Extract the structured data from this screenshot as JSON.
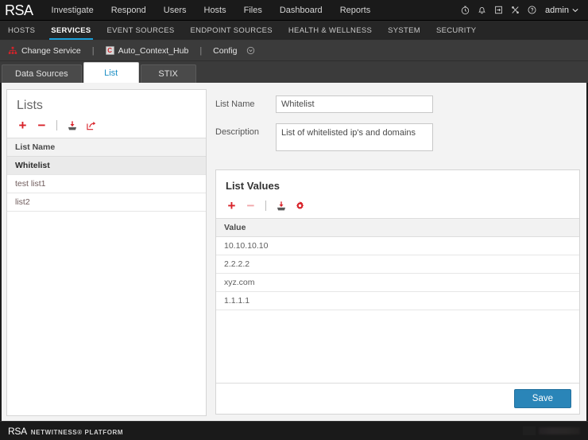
{
  "header": {
    "logo": "RSA",
    "nav": [
      {
        "label": "Investigate"
      },
      {
        "label": "Respond"
      },
      {
        "label": "Users"
      },
      {
        "label": "Hosts"
      },
      {
        "label": "Files"
      },
      {
        "label": "Dashboard"
      },
      {
        "label": "Reports"
      }
    ],
    "icons": [
      {
        "name": "timer-icon"
      },
      {
        "name": "bell-icon"
      },
      {
        "name": "tasks-icon"
      },
      {
        "name": "shortcuts-icon"
      },
      {
        "name": "help-icon"
      }
    ],
    "user": "admin"
  },
  "subnav": {
    "items": [
      {
        "label": "HOSTS",
        "active": false
      },
      {
        "label": "SERVICES",
        "active": true
      },
      {
        "label": "EVENT SOURCES",
        "active": false
      },
      {
        "label": "ENDPOINT SOURCES",
        "active": false
      },
      {
        "label": "HEALTH & WELLNESS",
        "active": false
      },
      {
        "label": "SYSTEM",
        "active": false
      },
      {
        "label": "SECURITY",
        "active": false
      }
    ]
  },
  "servicebar": {
    "change_service": "Change Service",
    "service_chip": "C",
    "service_name": "Auto_Context_Hub",
    "config_label": "Config",
    "separator": "|"
  },
  "tabs": [
    {
      "label": "Data Sources",
      "active": false
    },
    {
      "label": "List",
      "active": true
    },
    {
      "label": "STIX",
      "active": false
    }
  ],
  "lists_panel": {
    "title": "Lists",
    "toolbar": [
      {
        "name": "add-list-icon",
        "glyph": "+",
        "disabled": false
      },
      {
        "name": "remove-list-icon",
        "glyph": "−",
        "disabled": false
      },
      {
        "name": "import-list-icon",
        "glyph": "import",
        "disabled": false
      },
      {
        "name": "export-list-icon",
        "glyph": "export",
        "disabled": false
      }
    ],
    "column_header": "List Name",
    "rows": [
      {
        "name": "Whitelist",
        "selected": true
      },
      {
        "name": "test list1",
        "selected": false
      },
      {
        "name": "list2",
        "selected": false
      }
    ]
  },
  "form": {
    "list_name_label": "List Name",
    "list_name_value": "Whitelist",
    "list_name_placeholder": "",
    "description_label": "Description",
    "description_value": "List of whitelisted ip's and domains",
    "description_placeholder": ""
  },
  "values_panel": {
    "title": "List Values",
    "toolbar": [
      {
        "name": "add-value-icon",
        "glyph": "+",
        "disabled": false
      },
      {
        "name": "remove-value-icon",
        "glyph": "−",
        "disabled": true
      },
      {
        "name": "import-values-icon",
        "glyph": "import",
        "disabled": false
      },
      {
        "name": "settings-icon",
        "glyph": "gear",
        "disabled": false
      }
    ],
    "column_header": "Value",
    "rows": [
      {
        "value": "10.10.10.10"
      },
      {
        "value": "2.2.2.2"
      },
      {
        "value": "xyz.com"
      },
      {
        "value": "1.1.1.1"
      }
    ],
    "save_label": "Save"
  },
  "footer": {
    "logo": "RSA",
    "product": "NETWITNESS® PLATFORM"
  },
  "colors": {
    "accent_blue": "#1a9fd9",
    "action_red": "#d8232a",
    "save_button": "#2a85b8",
    "topbar_bg": "#1a1a1a",
    "subnav_bg": "#262626",
    "servicebar_bg": "#3b3b3b",
    "content_bg": "#f3f3f3"
  }
}
